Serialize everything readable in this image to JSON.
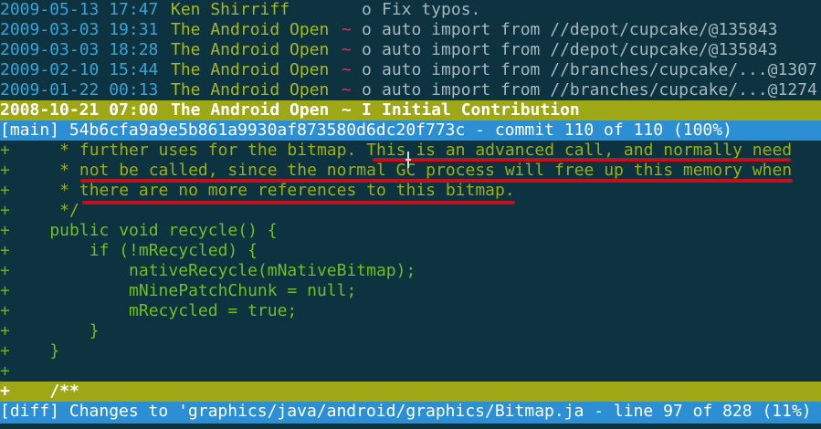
{
  "log": [
    {
      "date": "2009-05-13 17:47",
      "author": "Ken Shirriff",
      "tilde": "",
      "marker": "o",
      "message": "Fix typos."
    },
    {
      "date": "2009-03-03 19:31",
      "author": "The Android Open",
      "tilde": "~",
      "marker": "o",
      "message": "auto import from //depot/cupcake/@135843"
    },
    {
      "date": "2009-03-03 18:28",
      "author": "The Android Open",
      "tilde": "~",
      "marker": "o",
      "message": "auto import from //depot/cupcake/@135843"
    },
    {
      "date": "2009-02-10 15:44",
      "author": "The Android Open",
      "tilde": "~",
      "marker": "o",
      "message": "auto import from //branches/cupcake/...@1307"
    },
    {
      "date": "2009-01-22 00:13",
      "author": "The Android Open",
      "tilde": "~",
      "marker": "o",
      "message": "auto import from //branches/cupcake/...@1274"
    }
  ],
  "selected": {
    "date": "2008-10-21 07:00",
    "author": "The Android Open",
    "tilde": "~",
    "marker": "I",
    "message": "Initial Contribution"
  },
  "main_status": "[main] 54b6cfa9a9e5b861a9930af873580d6dc20f773c - commit 110 of 110 (100%)",
  "diff_lines": [
    {
      "prefix": "+",
      "text": "     * further uses for the bitmap. This is an advanced call, and normally need",
      "kind": "comment"
    },
    {
      "prefix": "+",
      "text": "     * not be called, since the normal GC process will free up this memory when",
      "kind": "comment"
    },
    {
      "prefix": "+",
      "text": "     * there are no more references to this bitmap.",
      "kind": "comment"
    },
    {
      "prefix": "+",
      "text": "     */",
      "kind": "comment"
    },
    {
      "prefix": "+",
      "text": "    public void recycle() {",
      "kind": "code"
    },
    {
      "prefix": "+",
      "text": "        if (!mRecycled) {",
      "kind": "code"
    },
    {
      "prefix": "+",
      "text": "            nativeRecycle(mNativeBitmap);",
      "kind": "code"
    },
    {
      "prefix": "+",
      "text": "            mNinePatchChunk = null;",
      "kind": "code"
    },
    {
      "prefix": "+",
      "text": "            mRecycled = true;",
      "kind": "code"
    },
    {
      "prefix": "+",
      "text": "        }",
      "kind": "code"
    },
    {
      "prefix": "+",
      "text": "    }",
      "kind": "code"
    },
    {
      "prefix": "+",
      "text": "",
      "kind": "code"
    }
  ],
  "diff_selected": {
    "prefix": "+",
    "text": "    /**"
  },
  "diff_status": "[diff] Changes to 'graphics/java/android/graphics/Bitmap.ja - line 97 of 828 (11%)",
  "colors": {
    "background": "#0d3341",
    "selection_bar": "#9ea715",
    "status_bar": "#2c8fd3",
    "annotation_underline": "#c4101a"
  }
}
